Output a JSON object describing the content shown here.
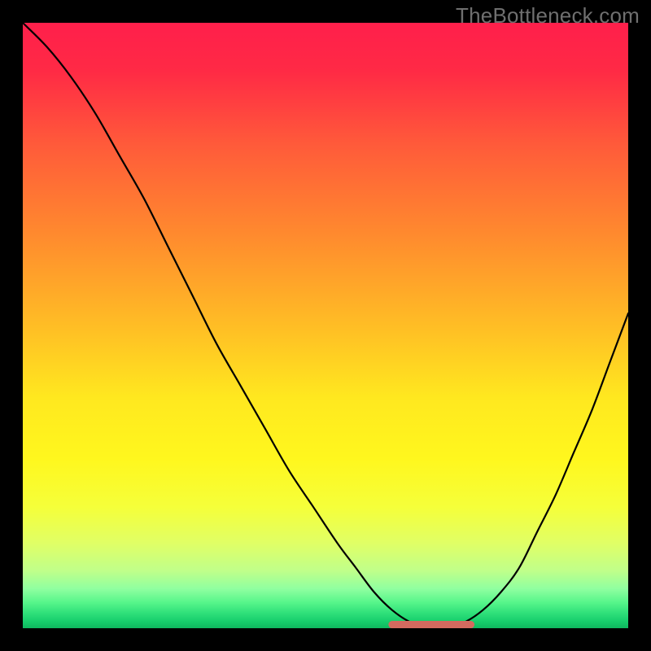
{
  "watermark": "TheBottleneck.com",
  "colors": {
    "frame": "#000000",
    "watermark": "#6f6f6f",
    "curve": "#000000",
    "marker_fill": "#d46a5f",
    "marker_stroke": "#b04f45",
    "gradient_stops": [
      {
        "offset": 0.0,
        "color": "#ff1f4b"
      },
      {
        "offset": 0.08,
        "color": "#ff2a45"
      },
      {
        "offset": 0.2,
        "color": "#ff5a3a"
      },
      {
        "offset": 0.35,
        "color": "#ff8a2e"
      },
      {
        "offset": 0.5,
        "color": "#ffbd25"
      },
      {
        "offset": 0.62,
        "color": "#ffe81f"
      },
      {
        "offset": 0.72,
        "color": "#fff71e"
      },
      {
        "offset": 0.8,
        "color": "#f5ff3a"
      },
      {
        "offset": 0.86,
        "color": "#e0ff66"
      },
      {
        "offset": 0.905,
        "color": "#c0ff8a"
      },
      {
        "offset": 0.935,
        "color": "#8fffa0"
      },
      {
        "offset": 0.958,
        "color": "#55f58a"
      },
      {
        "offset": 0.975,
        "color": "#2fe07a"
      },
      {
        "offset": 0.988,
        "color": "#18cf6d"
      },
      {
        "offset": 1.0,
        "color": "#0fb85f"
      }
    ]
  },
  "chart_data": {
    "type": "line",
    "title": "",
    "xlabel": "",
    "ylabel": "",
    "xlim": [
      0,
      100
    ],
    "ylim": [
      0,
      100
    ],
    "grid": false,
    "series": [
      {
        "name": "curve",
        "x": [
          0,
          4,
          8,
          12,
          16,
          20,
          24,
          28,
          32,
          36,
          40,
          44,
          48,
          52,
          55,
          58,
          61,
          64,
          67,
          70,
          73,
          76,
          79,
          82,
          85,
          88,
          91,
          94,
          97,
          100
        ],
        "y": [
          100,
          96,
          91,
          85,
          78,
          71,
          63,
          55,
          47,
          40,
          33,
          26,
          20,
          14,
          10,
          6,
          3,
          1,
          0,
          0,
          1,
          3,
          6,
          10,
          16,
          22,
          29,
          36,
          44,
          52
        ]
      }
    ],
    "flat_region": {
      "x_start": 61,
      "x_end": 74,
      "y": 0.6
    },
    "annotations": []
  }
}
